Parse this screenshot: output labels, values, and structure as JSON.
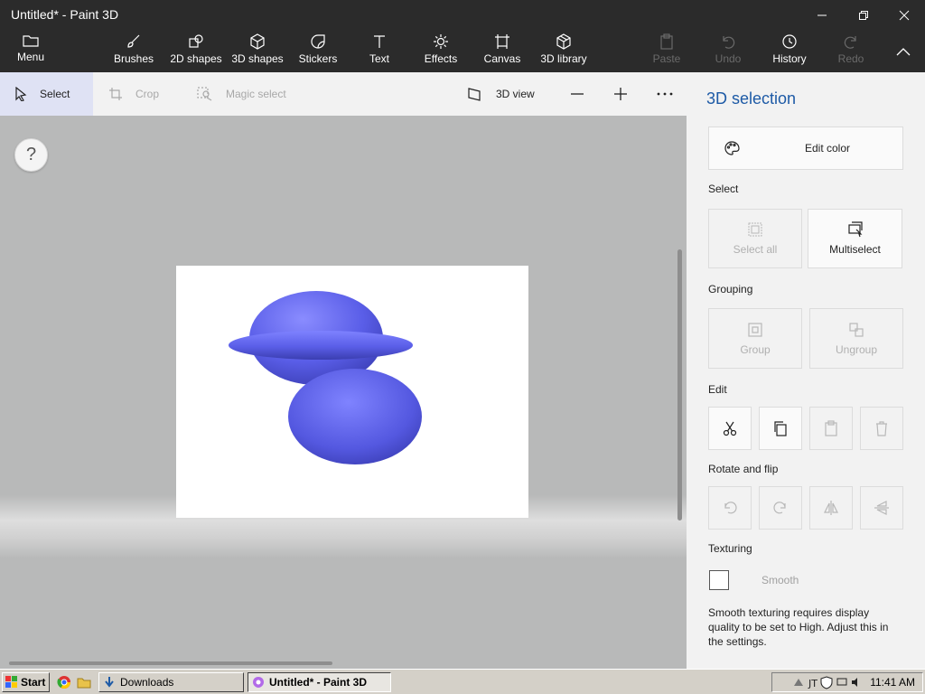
{
  "window": {
    "title": "Untitled* - Paint 3D"
  },
  "ribbon": {
    "menu": "Menu",
    "items": [
      {
        "label": "Brushes"
      },
      {
        "label": "2D shapes"
      },
      {
        "label": "3D shapes"
      },
      {
        "label": "Stickers"
      },
      {
        "label": "Text"
      },
      {
        "label": "Effects"
      },
      {
        "label": "Canvas"
      },
      {
        "label": "3D library"
      }
    ],
    "paste": "Paste",
    "undo": "Undo",
    "history": "History",
    "redo": "Redo"
  },
  "toolbar": {
    "select": "Select",
    "crop": "Crop",
    "magic_select": "Magic select",
    "view_3d": "3D view"
  },
  "canvas": {
    "help": "?"
  },
  "panel": {
    "title": "3D selection",
    "edit_color": "Edit color",
    "select_section": "Select",
    "select_all": "Select all",
    "multiselect": "Multiselect",
    "grouping_section": "Grouping",
    "group": "Group",
    "ungroup": "Ungroup",
    "edit_section": "Edit",
    "rotate_section": "Rotate and flip",
    "texturing_section": "Texturing",
    "smooth": "Smooth",
    "note": "Smooth texturing requires display quality to be set to High. Adjust this in the settings."
  },
  "taskbar": {
    "start": "Start",
    "downloads": "Downloads",
    "paint_task": "Untitled* - Paint 3D",
    "clock": "11:41 AM"
  },
  "colors": {
    "accent": "#1d5aa6",
    "shape": "#5a5ee8"
  }
}
